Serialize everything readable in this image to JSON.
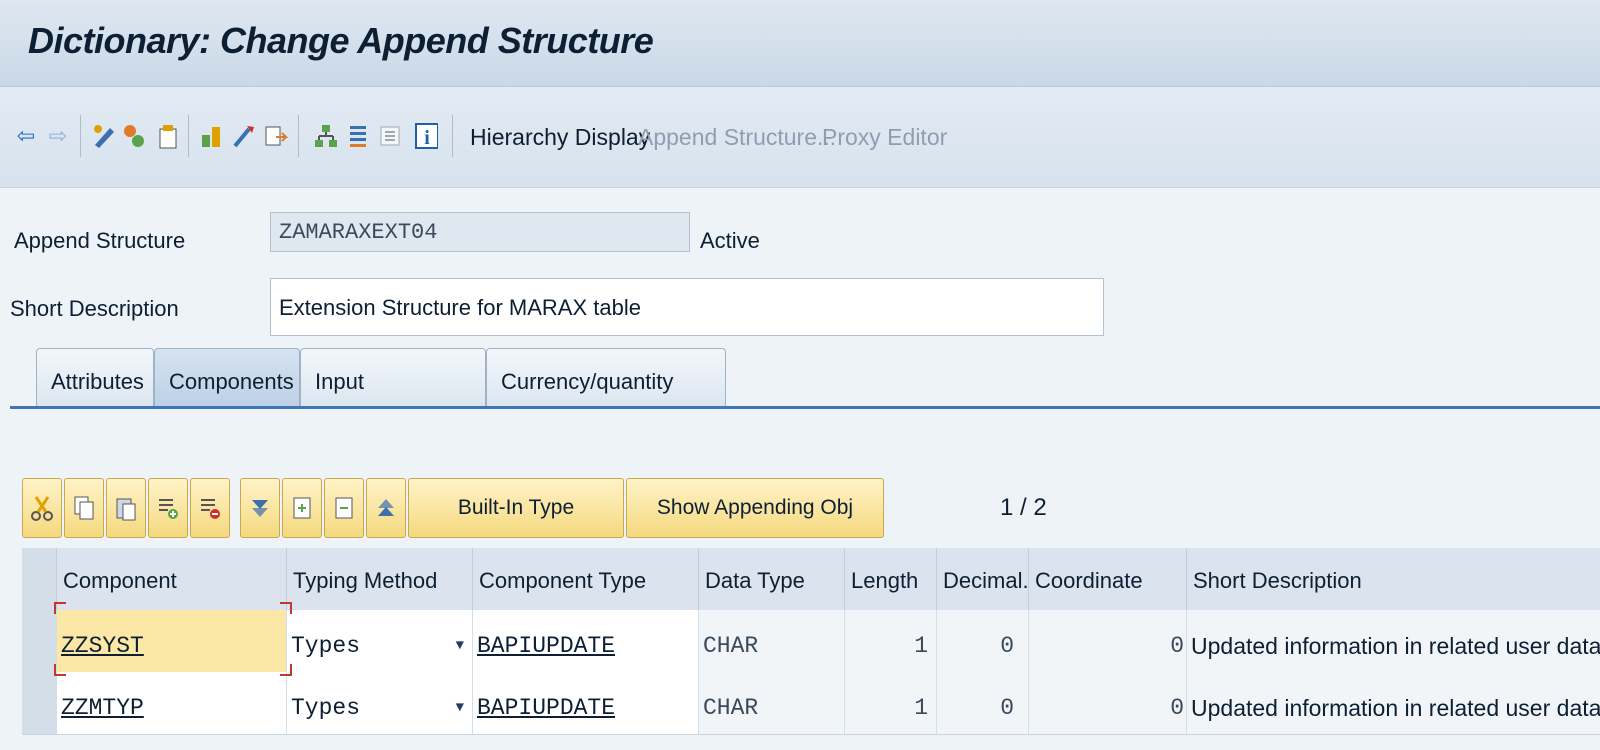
{
  "window": {
    "title": "Dictionary: Change Append Structure"
  },
  "toolbar": {
    "icons": [
      "back-icon",
      "forward-icon",
      "display-change-icon",
      "other-object-icon",
      "check-icon",
      "activate-icon",
      "where-used-icon",
      "object-list-icon",
      "hierarchy-icon",
      "navigation-icon",
      "documentation-icon",
      "info-icon"
    ],
    "hierarchy_display": "Hierarchy Display",
    "append_structure": "Append Structure...",
    "proxy_editor": "Proxy Editor"
  },
  "header": {
    "append_structure_label": "Append Structure",
    "append_structure_value": "ZAMARAXEXT04",
    "status": "Active",
    "short_description_label": "Short Description",
    "short_description_value": "Extension Structure for MARAX table"
  },
  "tabs": [
    {
      "label": "Attributes"
    },
    {
      "label": "Components"
    },
    {
      "label": "Input Help/Check"
    },
    {
      "label": "Currency/quantity fields"
    }
  ],
  "active_tab": "Components",
  "components_toolbar": {
    "icons": [
      "cut-icon",
      "copy-icon",
      "paste-icon",
      "insert-row-icon",
      "delete-row-icon",
      "scroll-down-icon",
      "first-page-icon",
      "last-page-icon",
      "scroll-up-icon"
    ],
    "built_in_type": "Built-In Type",
    "show_appending_obj": "Show Appending Obj",
    "pager": "1 / 2"
  },
  "table": {
    "columns": [
      "Component",
      "Typing Method",
      "Component Type",
      "Data Type",
      "Length",
      "Decimal...",
      "Coordinate",
      "Short Description"
    ],
    "rows": [
      {
        "component": "ZZSYST",
        "typing_method": "Types",
        "component_type": "BAPIUPDATE",
        "data_type": "CHAR",
        "length": "1",
        "decimals": "0",
        "coordinate": "0",
        "short_description": "Updated information in related user data field"
      },
      {
        "component": "ZZMTYP",
        "typing_method": "Types",
        "component_type": "BAPIUPDATE",
        "data_type": "CHAR",
        "length": "1",
        "decimals": "0",
        "coordinate": "0",
        "short_description": "Updated information in related user data field"
      }
    ]
  },
  "colors": {
    "accent": "#3d78b5",
    "button_yellow": "#f5d97e",
    "focus_field": "#fbe7a6"
  }
}
